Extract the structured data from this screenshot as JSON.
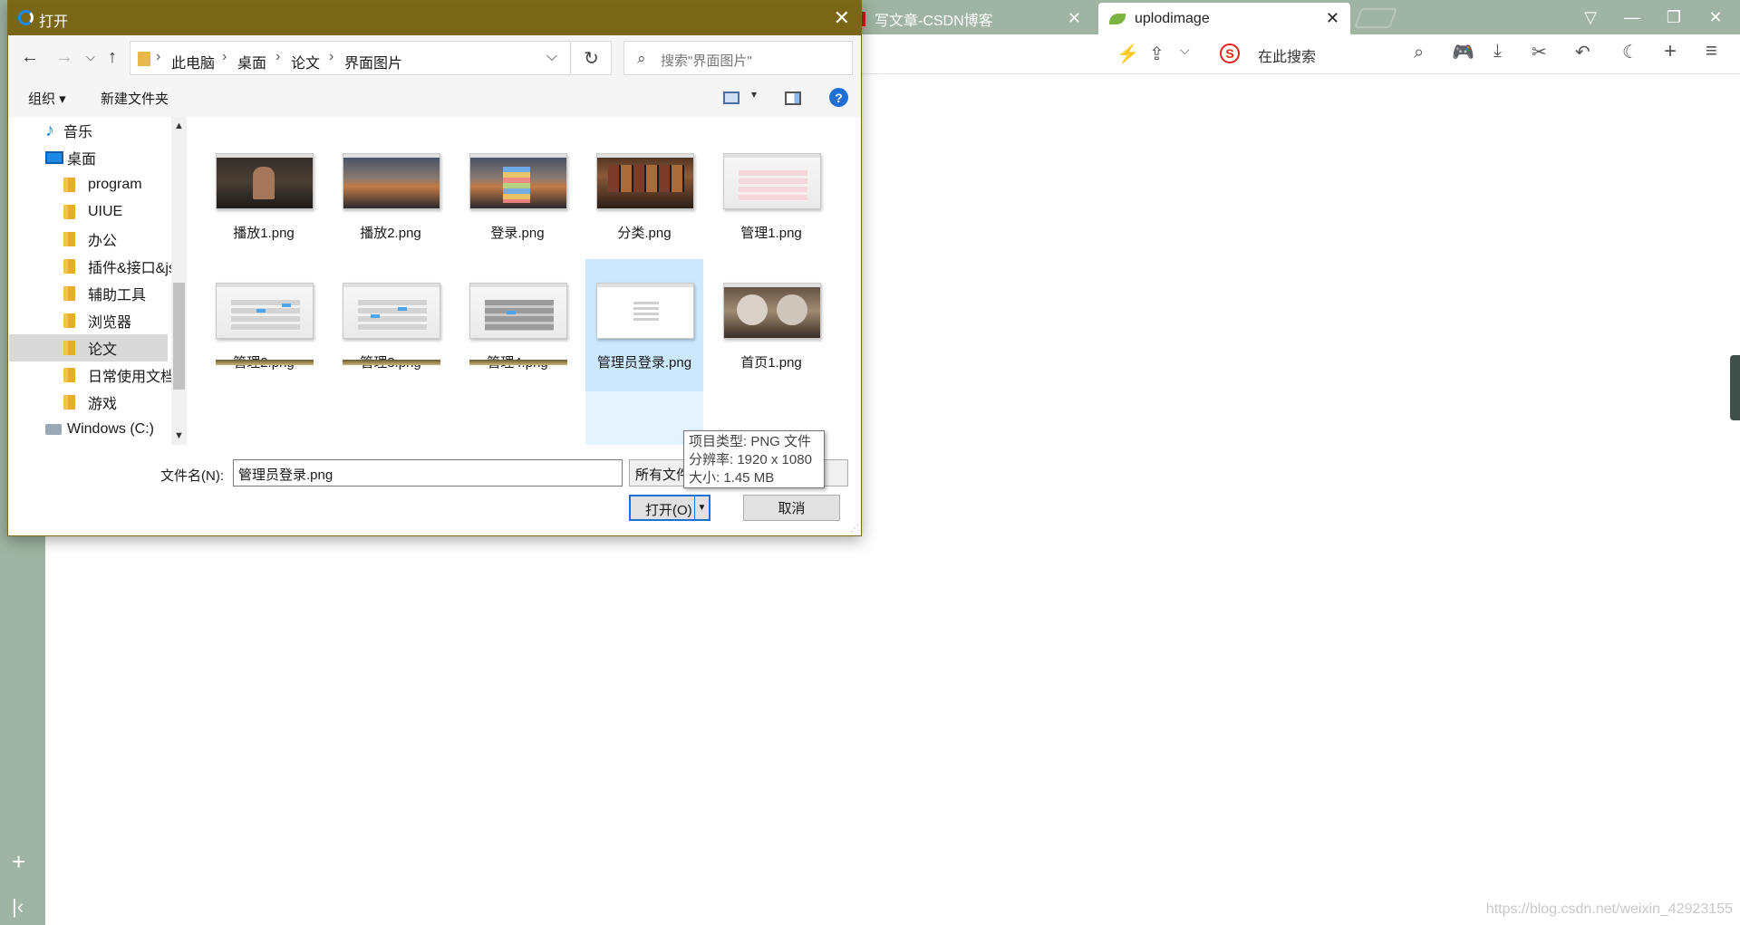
{
  "browser": {
    "tabs": [
      {
        "label": "写文章-CSDN博客",
        "active": false
      },
      {
        "label": "uplodimage",
        "active": true
      }
    ],
    "search_placeholder": "在此搜索",
    "watermark": "https://blog.csdn.net/weixin_42923155",
    "tab_close_glyph": "✕"
  },
  "dialog": {
    "title": "打开",
    "close_glyph": "✕",
    "breadcrumb": [
      "此电脑",
      "桌面",
      "论文",
      "界面图片"
    ],
    "search_placeholder": "搜索\"界面图片\"",
    "toolbar": {
      "organize": "组织 ▾",
      "new_folder": "新建文件夹",
      "help": "?"
    },
    "tree": [
      {
        "label": "音乐",
        "type": "music"
      },
      {
        "label": "桌面",
        "type": "desktop"
      },
      {
        "label": "program",
        "type": "folder"
      },
      {
        "label": "UIUE",
        "type": "folder"
      },
      {
        "label": "办公",
        "type": "folder"
      },
      {
        "label": "插件&接口&js",
        "type": "folder"
      },
      {
        "label": "辅助工具",
        "type": "folder"
      },
      {
        "label": "浏览器",
        "type": "folder"
      },
      {
        "label": "论文",
        "type": "folder",
        "selected": true
      },
      {
        "label": "日常使用文档",
        "type": "folder"
      },
      {
        "label": "游戏",
        "type": "folder"
      },
      {
        "label": "Windows (C:)",
        "type": "drive"
      }
    ],
    "files": [
      {
        "name": "播放1.png",
        "thumb": "dark"
      },
      {
        "name": "播放2.png",
        "thumb": "sunset"
      },
      {
        "name": "登录.png",
        "thumb": "sunset-login"
      },
      {
        "name": "分类.png",
        "thumb": "movies"
      },
      {
        "name": "管理1.png",
        "thumb": "admin"
      },
      {
        "name": "管理2.png",
        "thumb": "admin"
      },
      {
        "name": "管理3.png",
        "thumb": "admin"
      },
      {
        "name": "管理4.png",
        "thumb": "admin-dim"
      },
      {
        "name": "管理员登录.png",
        "thumb": "white",
        "selected": true
      },
      {
        "name": "首页1.png",
        "thumb": "bears"
      }
    ],
    "filename_label": "文件名(N):",
    "filename_value": "管理员登录.png",
    "filetype_value": "所有文件",
    "open_button": "打开(O)",
    "cancel_button": "取消",
    "tooltip": {
      "type": "项目类型: PNG 文件",
      "resolution": "分辨率: 1920 x 1080",
      "size": "大小: 1.45 MB"
    }
  },
  "colors": {
    "titlebar": "#7a6617",
    "browser_chrome": "#9fb4a2",
    "selection": "#cce8ff",
    "accent": "#1e6fd6"
  }
}
